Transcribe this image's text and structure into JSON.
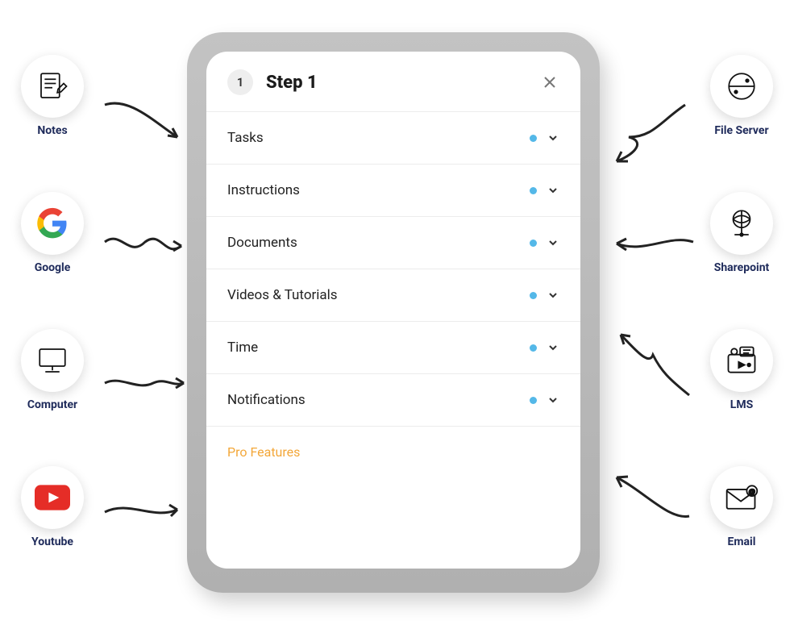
{
  "left": [
    {
      "label": "Notes",
      "icon": "notes-icon"
    },
    {
      "label": "Google",
      "icon": "google-icon"
    },
    {
      "label": "Computer",
      "icon": "computer-icon"
    },
    {
      "label": "Youtube",
      "icon": "youtube-icon"
    }
  ],
  "right": [
    {
      "label": "File Server",
      "icon": "file-server-icon"
    },
    {
      "label": "Sharepoint",
      "icon": "sharepoint-icon"
    },
    {
      "label": "LMS",
      "icon": "lms-icon"
    },
    {
      "label": "Email",
      "icon": "email-icon"
    }
  ],
  "panel": {
    "step_number": "1",
    "step_title": "Step 1",
    "sections": [
      {
        "label": "Tasks"
      },
      {
        "label": "Instructions"
      },
      {
        "label": "Documents"
      },
      {
        "label": "Videos & Tutorials"
      },
      {
        "label": "Time"
      },
      {
        "label": "Notifications"
      }
    ],
    "footer_label": "Pro Features"
  },
  "colors": {
    "accent_dot": "#54b8e8",
    "label_navy": "#1e2a5a",
    "pro_orange": "#f3a739"
  }
}
